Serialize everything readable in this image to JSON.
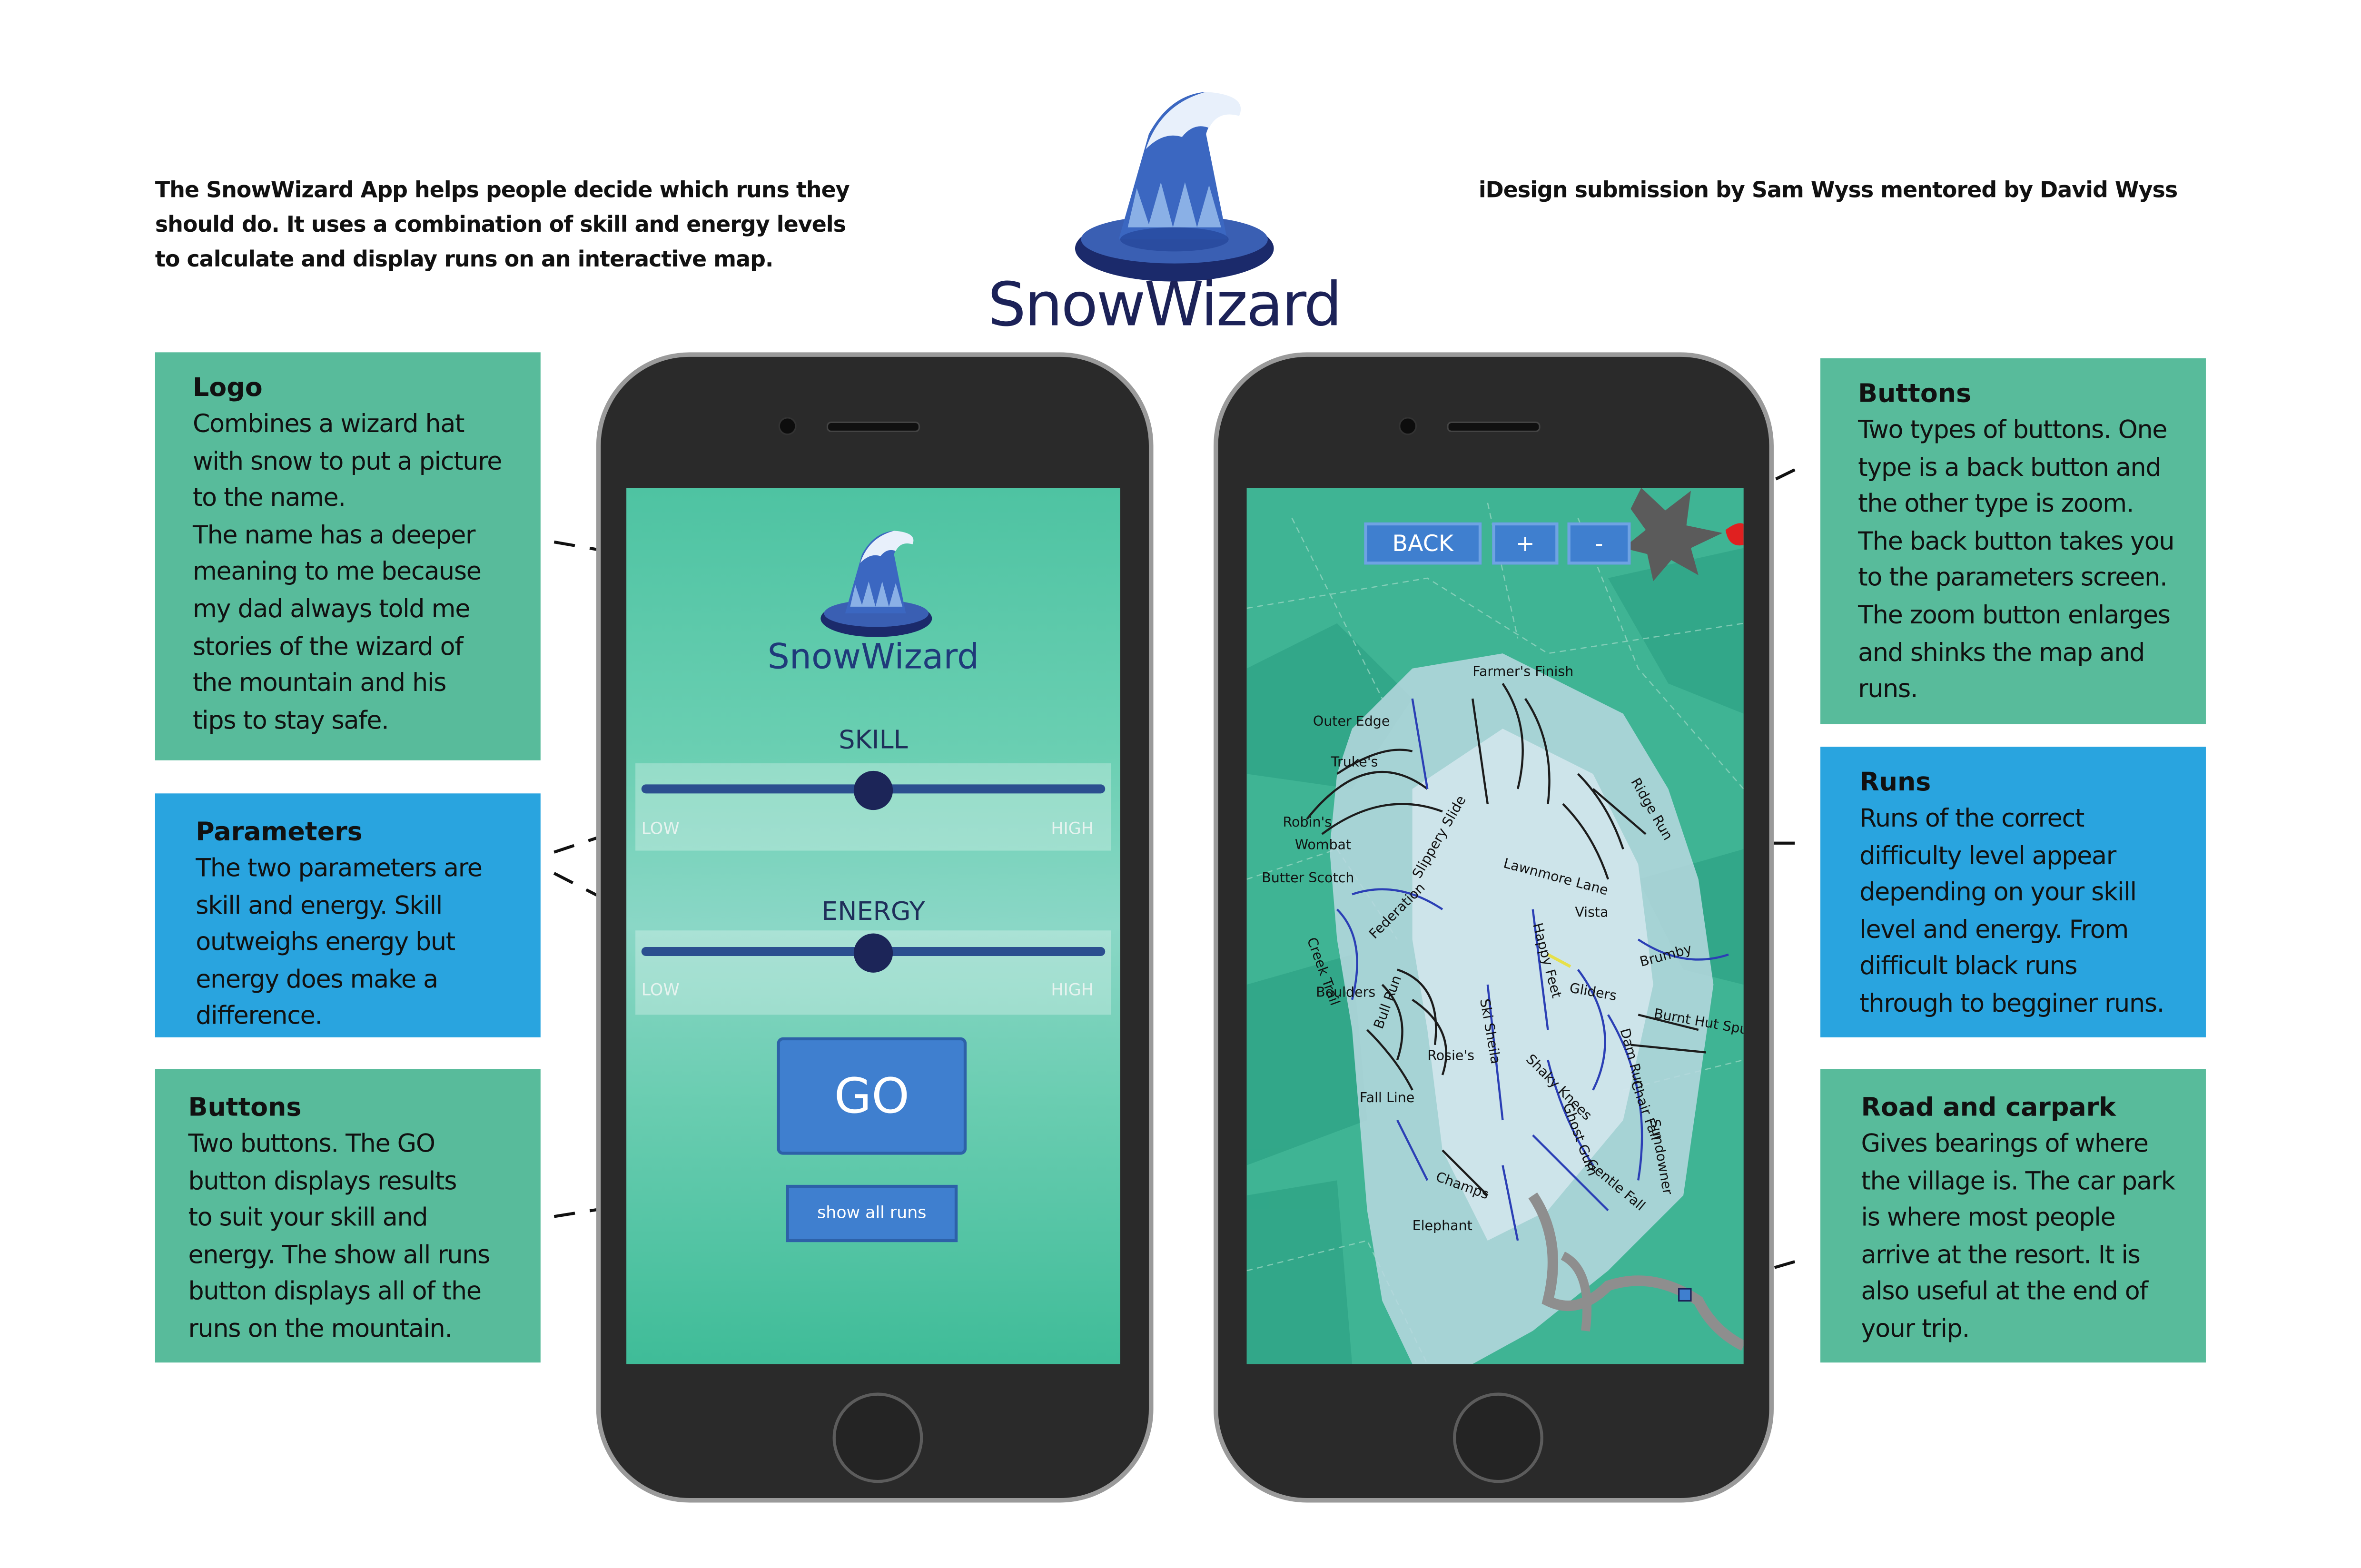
{
  "intro": [
    "The SnowWizard App helps people decide which runs they",
    "should do. It uses a combination of skill and energy levels",
    "to calculate and display runs on an interactive map."
  ],
  "credit": "iDesign submission by Sam Wyss mentored by David Wyss",
  "logo_text": "SnowWizard",
  "colors": {
    "green_box": "#58bb9b",
    "blue_box": "#29a4df",
    "button": "#3f7fcf",
    "logo_navy": "#1c2258"
  },
  "callouts": {
    "logo": {
      "heading": "Logo",
      "lines": [
        "Combines a wizard hat",
        "with snow to put a picture",
        "to the name.",
        "The name has a deeper",
        "meaning to me because",
        "my dad always told me",
        "stories of the wizard of",
        "the mountain and his",
        "tips to stay safe."
      ]
    },
    "parameters": {
      "heading": "Parameters",
      "lines": [
        "The two parameters are",
        "skill and energy. Skill",
        "outweighs energy but",
        "energy does make a",
        "difference."
      ]
    },
    "buttons_left": {
      "heading": "Buttons",
      "lines": [
        "Two buttons. The GO",
        "button displays results",
        "to suit your skill and",
        "energy. The show all runs",
        "button displays all of the",
        "runs on the mountain."
      ]
    },
    "buttons_right": {
      "heading": "Buttons",
      "lines": [
        "Two types of buttons. One",
        "type is a back button and",
        "the other type is zoom.",
        "The back button takes you",
        "to the parameters screen.",
        "The zoom button enlarges",
        "and shinks the map and",
        "runs."
      ]
    },
    "runs": {
      "heading": "Runs",
      "lines": [
        "Runs of the correct",
        "difficulty level appear",
        "depending on your skill",
        "level and energy. From",
        "difficult black runs",
        "through to begginer runs."
      ]
    },
    "road": {
      "heading": "Road and carpark",
      "lines": [
        "Gives bearings of where",
        "the village is. The car park",
        "is where most people",
        "arrive at the resort. It is",
        "also useful at the end of",
        "your trip."
      ]
    }
  },
  "app": {
    "logo_text": "SnowWizard",
    "skill": {
      "label": "SKILL",
      "low": "LOW",
      "high": "HIGH",
      "level": 0.5
    },
    "energy": {
      "label": "ENERGY",
      "low": "LOW",
      "high": "HIGH",
      "level": 0.5
    },
    "go_label": "GO",
    "show_all_label": "show all runs"
  },
  "map": {
    "back_label": "BACK",
    "zoom_in_label": "+",
    "zoom_out_label": "-",
    "run_labels": [
      "Farmer's Finish",
      "Outer Edge",
      "Truke's",
      "Robin's",
      "Wombat",
      "Butter Scotch",
      "Boulders",
      "Federation",
      "Creek Trail",
      "Ridge Run",
      "Lawnmore Lane",
      "Vista",
      "Brumby",
      "Gliders",
      "Burnt Hut Spur",
      "Bull Run",
      "Happy Feet",
      "Ski Sheila",
      "Rosie's",
      "Fall Line",
      "Champs",
      "Elephant",
      "Shaky Knees",
      "Gentle Fall",
      "Dam Run",
      "Chair Fall",
      "Sundowner",
      "Slippery Slide",
      "Ghost Gum"
    ]
  }
}
